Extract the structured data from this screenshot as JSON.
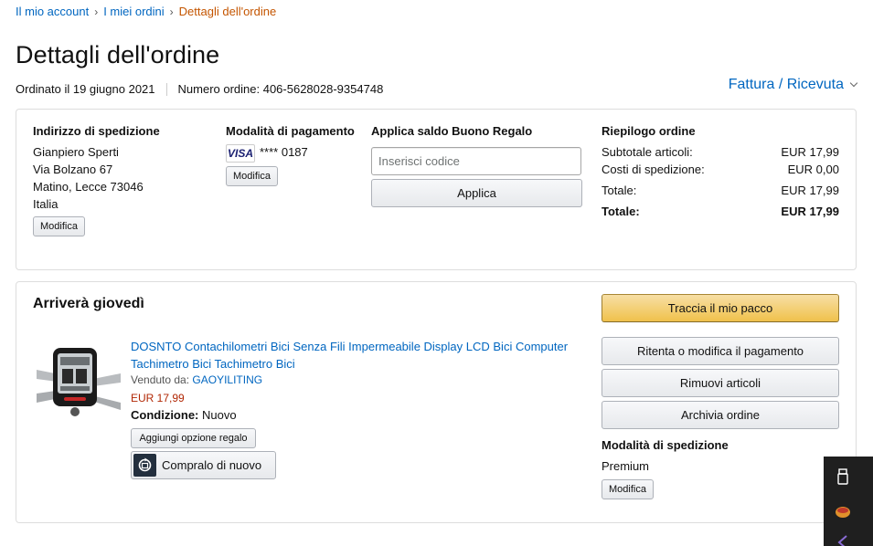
{
  "breadcrumb": {
    "items": [
      "Il mio account",
      "I miei ordini"
    ],
    "separator": "›",
    "current": "Dettagli dell'ordine"
  },
  "page_title": "Dettagli dell'ordine",
  "order_meta": {
    "ordered": "Ordinato il 19 giugno 2021",
    "order_number": "Numero ordine: 406-5628028-9354748"
  },
  "invoice_link": "Fattura / Ricevuta",
  "shipping_address": {
    "heading": "Indirizzo di spedizione",
    "lines": [
      "Gianpiero Sperti",
      "Via Bolzano 67",
      "Matino, Lecce 73046",
      "Italia"
    ],
    "edit_label": "Modifica"
  },
  "payment": {
    "heading": "Modalità di pagamento",
    "card_brand": "VISA",
    "card_number": "**** 0187",
    "edit_label": "Modifica"
  },
  "gift_card": {
    "heading": "Applica saldo Buono Regalo",
    "placeholder": "Inserisci codice",
    "apply_label": "Applica"
  },
  "summary": {
    "heading": "Riepilogo ordine",
    "rows": [
      {
        "label": "Subtotale articoli:",
        "value": "EUR 17,99"
      },
      {
        "label": "Costi di spedizione:",
        "value": "EUR 0,00"
      },
      {
        "label": "Totale:",
        "value": "EUR 17,99"
      },
      {
        "label": "Totale:",
        "value": "EUR 17,99"
      }
    ]
  },
  "shipment": {
    "arrival": "Arriverà giovedì",
    "product": {
      "title": "DOSNTO Contachilometri Bici Senza Fili Impermeabile Display LCD Bici Computer Tachimetro Bici Tachimetro Bici",
      "sold_by_label": "Venduto da:",
      "seller": "GAOYILITING",
      "price": "EUR 17,99",
      "condition_label": "Condizione:",
      "condition_value": "Nuovo",
      "gift_option_label": "Aggiungi opzione regalo",
      "buy_again_label": "Compralo di nuovo"
    },
    "actions": {
      "track": "Traccia il mio pacco",
      "retry_payment": "Ritenta o modifica il pagamento",
      "remove_items": "Rimuovi articoli",
      "archive": "Archivia ordine"
    },
    "shipping_method": {
      "heading": "Modalità di spedizione",
      "value": "Premium",
      "edit_label": "Modifica"
    }
  },
  "colors": {
    "link": "#0066c0",
    "breadcrumb_current": "#c45500",
    "price": "#b12704",
    "primary_button": "#f0c14b"
  }
}
